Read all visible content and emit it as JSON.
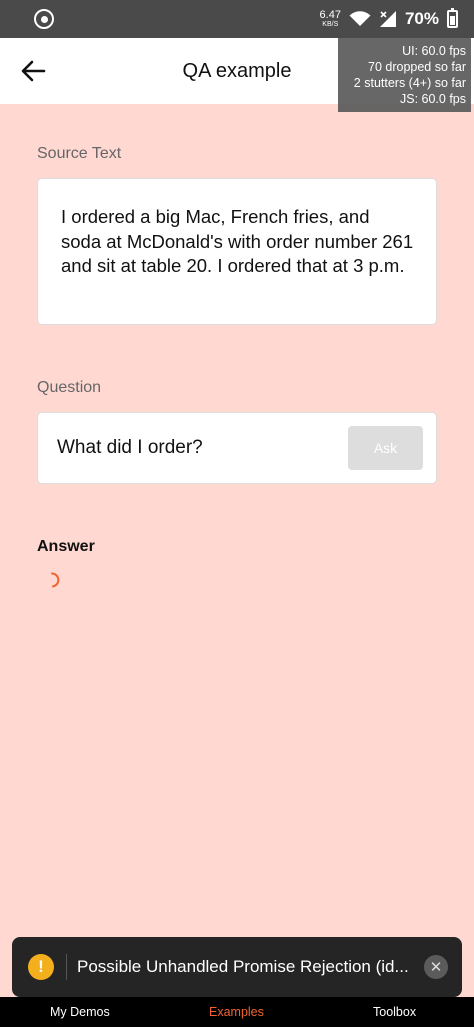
{
  "status_bar": {
    "net_speed_value": "6.47",
    "net_speed_unit": "KB/S",
    "battery_percent": "70%"
  },
  "header": {
    "title": "QA example"
  },
  "perf_monitor": {
    "ui_fps": "UI: 60.0 fps",
    "dropped": "70 dropped so far",
    "stutters": "2 stutters (4+) so far",
    "js_fps": "JS: 60.0 fps"
  },
  "source": {
    "label": "Source Text",
    "text": "I ordered a big Mac, French fries, and soda at McDonald's with order number 261 and sit at table 20. I ordered that at 3 p.m."
  },
  "question": {
    "label": "Question",
    "value": "What did I order?",
    "ask_label": "Ask"
  },
  "answer": {
    "label": "Answer"
  },
  "toast": {
    "message": "Possible Unhandled Promise Rejection (id..."
  },
  "tabs": [
    {
      "label": "My Demos"
    },
    {
      "label": "Examples",
      "active": true
    },
    {
      "label": "Toolbox"
    }
  ],
  "colors": {
    "background": "#ffd8d2",
    "accent": "#f26330",
    "warning": "#f4b01c"
  },
  "icons": {
    "app": "app-dot-icon",
    "wifi": "wifi-icon",
    "signal": "signal-icon",
    "battery": "battery-icon",
    "back": "back-arrow-icon",
    "warning": "warning-icon",
    "close": "close-icon",
    "loading": "spinner-icon"
  }
}
